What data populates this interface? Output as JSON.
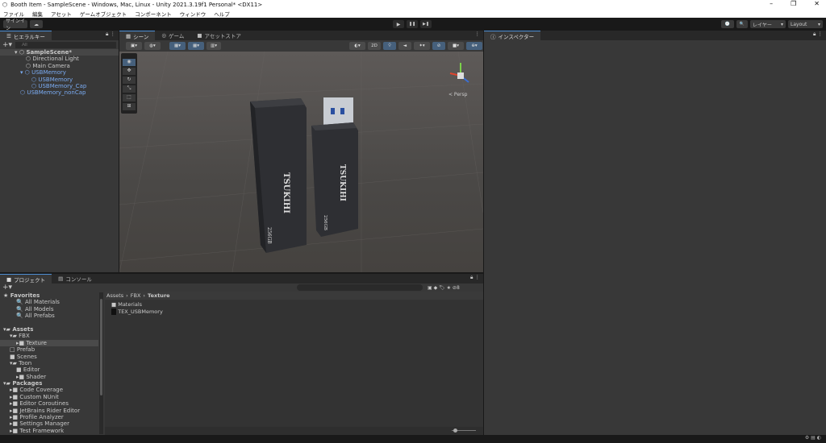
{
  "window": {
    "title": "Booth Item - SampleScene - Windows, Mac, Linux - Unity 2021.3.19f1 Personal* <DX11>",
    "controls": [
      "–",
      "❐",
      "✕"
    ]
  },
  "menu": [
    "ファイル",
    "編集",
    "アセット",
    "ゲームオブジェクト",
    "コンポーネント",
    "ウィンドウ",
    "ヘルプ"
  ],
  "toolbar": {
    "signin": "サインイン",
    "cloud": "☁",
    "play": "▶",
    "pause": "❚❚",
    "step": "▶❚",
    "history": "🕘",
    "search": "🔍",
    "layers": "レイヤー",
    "layout": "Layout"
  },
  "hierarchy": {
    "tab": "ヒエラルキー",
    "search_placeholder": "All",
    "items": [
      {
        "label": "SampleScene*",
        "indent": 0,
        "type": "scene"
      },
      {
        "label": "Directional Light",
        "indent": 2,
        "type": "object"
      },
      {
        "label": "Main Camera",
        "indent": 2,
        "type": "object"
      },
      {
        "label": "USBMemory",
        "indent": 1,
        "type": "prefab"
      },
      {
        "label": "USBMemory",
        "indent": 3,
        "type": "prefab-child"
      },
      {
        "label": "USBMemory_Cap",
        "indent": 3,
        "type": "prefab-child"
      },
      {
        "label": "USBMemory_nonCap",
        "indent": 1,
        "type": "prefab"
      }
    ]
  },
  "scene": {
    "tabs": [
      "シーン",
      "ゲーム",
      "アセットストア"
    ],
    "toggle_2d": "2D",
    "persp": "< Persp",
    "model_brand": "TSUKIHI",
    "model_capacity": "256GB"
  },
  "inspector": {
    "tab": "インスペクター"
  },
  "project": {
    "tabs": [
      "プロジェクト",
      "コンソール"
    ],
    "tree": [
      {
        "label": "Favorites",
        "indent": 0,
        "bold": true,
        "icon": "★"
      },
      {
        "label": "All Materials",
        "indent": 2,
        "icon": "🔍"
      },
      {
        "label": "All Models",
        "indent": 2,
        "icon": "🔍"
      },
      {
        "label": "All Prefabs",
        "indent": 2,
        "icon": "🔍"
      },
      {
        "label": "",
        "indent": 0,
        "icon": ""
      },
      {
        "label": "Assets",
        "indent": 0,
        "bold": true,
        "icon": "▾▰"
      },
      {
        "label": "FBX",
        "indent": 1,
        "icon": "▾▰"
      },
      {
        "label": "Texture",
        "indent": 2,
        "icon": "▸■",
        "selected": true
      },
      {
        "label": "Prefab",
        "indent": 1,
        "icon": "□"
      },
      {
        "label": "Scenes",
        "indent": 1,
        "icon": "■"
      },
      {
        "label": "Toon",
        "indent": 1,
        "icon": "▾▰"
      },
      {
        "label": "Editor",
        "indent": 2,
        "icon": "■"
      },
      {
        "label": "Shader",
        "indent": 2,
        "icon": "▸■"
      },
      {
        "label": "Packages",
        "indent": 0,
        "bold": true,
        "icon": "▾▰"
      },
      {
        "label": "Code Coverage",
        "indent": 1,
        "icon": "▸■"
      },
      {
        "label": "Custom NUnit",
        "indent": 1,
        "icon": "▸■"
      },
      {
        "label": "Editor Coroutines",
        "indent": 1,
        "icon": "▸■"
      },
      {
        "label": "JetBrains Rider Editor",
        "indent": 1,
        "icon": "▸■"
      },
      {
        "label": "Profile Analyzer",
        "indent": 1,
        "icon": "▸■"
      },
      {
        "label": "Settings Manager",
        "indent": 1,
        "icon": "▸■"
      },
      {
        "label": "Test Framework",
        "indent": 1,
        "icon": "▸■"
      }
    ],
    "breadcrumb": [
      "Assets",
      "FBX",
      "Texture"
    ],
    "files": [
      {
        "label": "Materials",
        "icon": "folder"
      },
      {
        "label": "TEX_USBMemory",
        "icon": "texture"
      }
    ],
    "hidden_count": "8"
  }
}
